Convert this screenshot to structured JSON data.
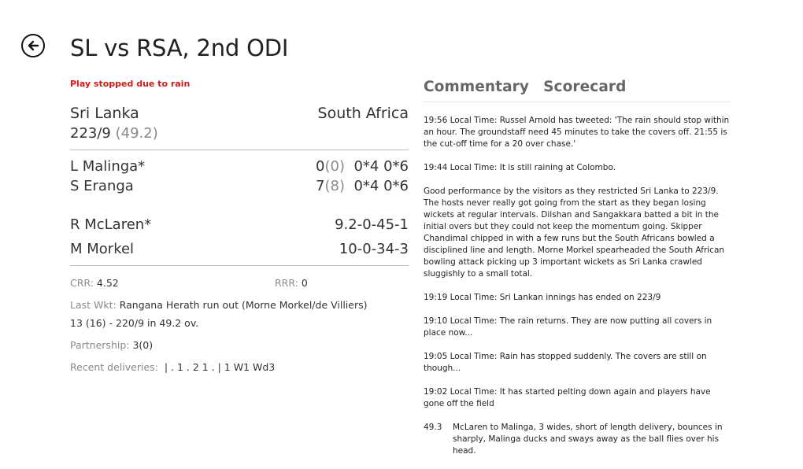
{
  "header": {
    "title": "SL vs RSA, 2nd ODI"
  },
  "status": "Play stopped due to rain",
  "match": {
    "batting_team": "Sri Lanka",
    "bowling_team": "South Africa",
    "score": "223/9",
    "overs": "(49.2)"
  },
  "batsmen": [
    {
      "name": "L Malinga*",
      "runs": "0",
      "balls": "(0)",
      "fours": "0*4",
      "sixes": "0*6"
    },
    {
      "name": "S Eranga",
      "runs": "7",
      "balls": "(8)",
      "fours": "0*4",
      "sixes": "0*6"
    }
  ],
  "bowlers": [
    {
      "name": "R McLaren*",
      "figures": "9.2-0-45-1"
    },
    {
      "name": "M Morkel",
      "figures": "10-0-34-3"
    }
  ],
  "stats": {
    "crr_label": "CRR:",
    "crr_value": "4.52",
    "rrr_label": "RRR:",
    "rrr_value": "0",
    "last_wkt_label": "Last Wkt:",
    "last_wkt_value": "Rangana Herath run out (Morne Morkel/de Villiers) 13 (16) - 220/9 in 49.2 ov.",
    "partnership_label": "Partnership:",
    "partnership_value": "3(0)",
    "recent_label": "Recent deliveries:",
    "recent_value": "| . 1 . 2 1 . | 1 W1 Wd3"
  },
  "tabs": {
    "commentary": "Commentary",
    "scorecard": "Scorecard"
  },
  "commentary": [
    "19:56 Local Time: Russel Arnold has tweeted: 'The rain should stop within an hour. The groundstaff need 45 minutes to take the covers off. 21:55 is the cut-off time for a 20 over chase.'",
    "19:44 Local Time: It is still raining at Colombo.",
    "Good performance by the visitors as they restricted Sri Lanka to 223/9. The hosts never really got going from the start as they began losing wickets at regular intervals. Dilshan and Sangakkara batted a bit in the initial overs but they could not keep the momentum going. Skipper Chandimal chipped in with a few runs but the South Africans bowled a disciplined line and length. Morne Morkel spearheaded the South African bowling attack picking up 3 important wickets as Sri Lanka crawled sluggishly to a small total.",
    "19:19 Local Time: Sri Lankan innings has ended on 223/9",
    "19:10 Local Time: The rain returns. They are now putting all covers in place now...",
    "19:05 Local Time: Rain has stopped suddenly. The covers are still on though...",
    "19:02 Local Time: It has started pelting down again and players have gone off the field"
  ],
  "ball_commentary": [
    {
      "over": "49.3",
      "text": "McLaren to Malinga, 3 wides, short of length delivery, bounces in sharply, Malinga ducks and sways away as the ball flies over his head."
    }
  ]
}
